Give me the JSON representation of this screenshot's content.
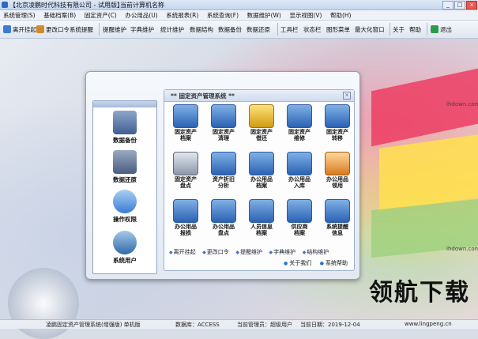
{
  "window": {
    "title": "【北京凌鹏时代科技有限公司 - 试用版】",
    "subtitle": "当前计算机名称"
  },
  "menubar": [
    "系统管理(S)",
    "基础档案(B)",
    "固定资产(C)",
    "办公用品(U)",
    "系统报表(R)",
    "系统查询(F)",
    "数据维护(W)",
    "显示视图(V)",
    "帮助(H)"
  ],
  "toolbar": [
    "离开挂起",
    "更改口令",
    "系统提醒",
    "提醒维护",
    "字典维护",
    "统计维护",
    "数据结构",
    "数据备份",
    "数据还原",
    "工具栏",
    "状态栏",
    "图形菜单",
    "最大化窗口",
    "关于",
    "帮助",
    "退出"
  ],
  "left_nav": [
    {
      "label": "数据备份",
      "icon": "backup-icon"
    },
    {
      "label": "数据还原",
      "icon": "restore-icon"
    },
    {
      "label": "操作权限",
      "icon": "permission-icon"
    },
    {
      "label": "系统用户",
      "icon": "user-icon"
    }
  ],
  "panel": {
    "title": "** 固定资产管理系统 **",
    "close": "×",
    "modules": [
      {
        "label": "固定资产\n档案"
      },
      {
        "label": "固定资产\n清理"
      },
      {
        "label": "固定资产\n借还"
      },
      {
        "label": "固定资产\n维修"
      },
      {
        "label": "固定资产\n转移"
      },
      {
        "label": "固定资产\n盘点"
      },
      {
        "label": "资产折旧\n分析"
      },
      {
        "label": "办公用品\n档案"
      },
      {
        "label": "办公用品\n入库"
      },
      {
        "label": "办公用品\n领用"
      },
      {
        "label": "办公用品\n报损"
      },
      {
        "label": "办公用品\n盘点"
      },
      {
        "label": "人员信息\n档案"
      },
      {
        "label": "供应商\n档案"
      },
      {
        "label": "系统提醒\n信息"
      }
    ],
    "quick_links": [
      "离开挂起",
      "更改口令",
      "提醒维护",
      "字典维护",
      "结构维护"
    ],
    "bottom_buttons": [
      "关于我们",
      "系统帮助"
    ]
  },
  "status": {
    "app": "凌鹏固定资产管理系统(增强版) 单机版",
    "db": "数据库：ACCESS",
    "manager": "当前管理员：超级用户",
    "date": "当前日期：2019-12-04"
  },
  "watermark": {
    "brand": "领航下载",
    "url": "www.lingpeng.cn",
    "site": "ihdown.com"
  },
  "colors": {
    "accent": "#2b62b3",
    "toolbar_bg": "#dfe6f1",
    "dialog_border": "#8f9fb8"
  }
}
